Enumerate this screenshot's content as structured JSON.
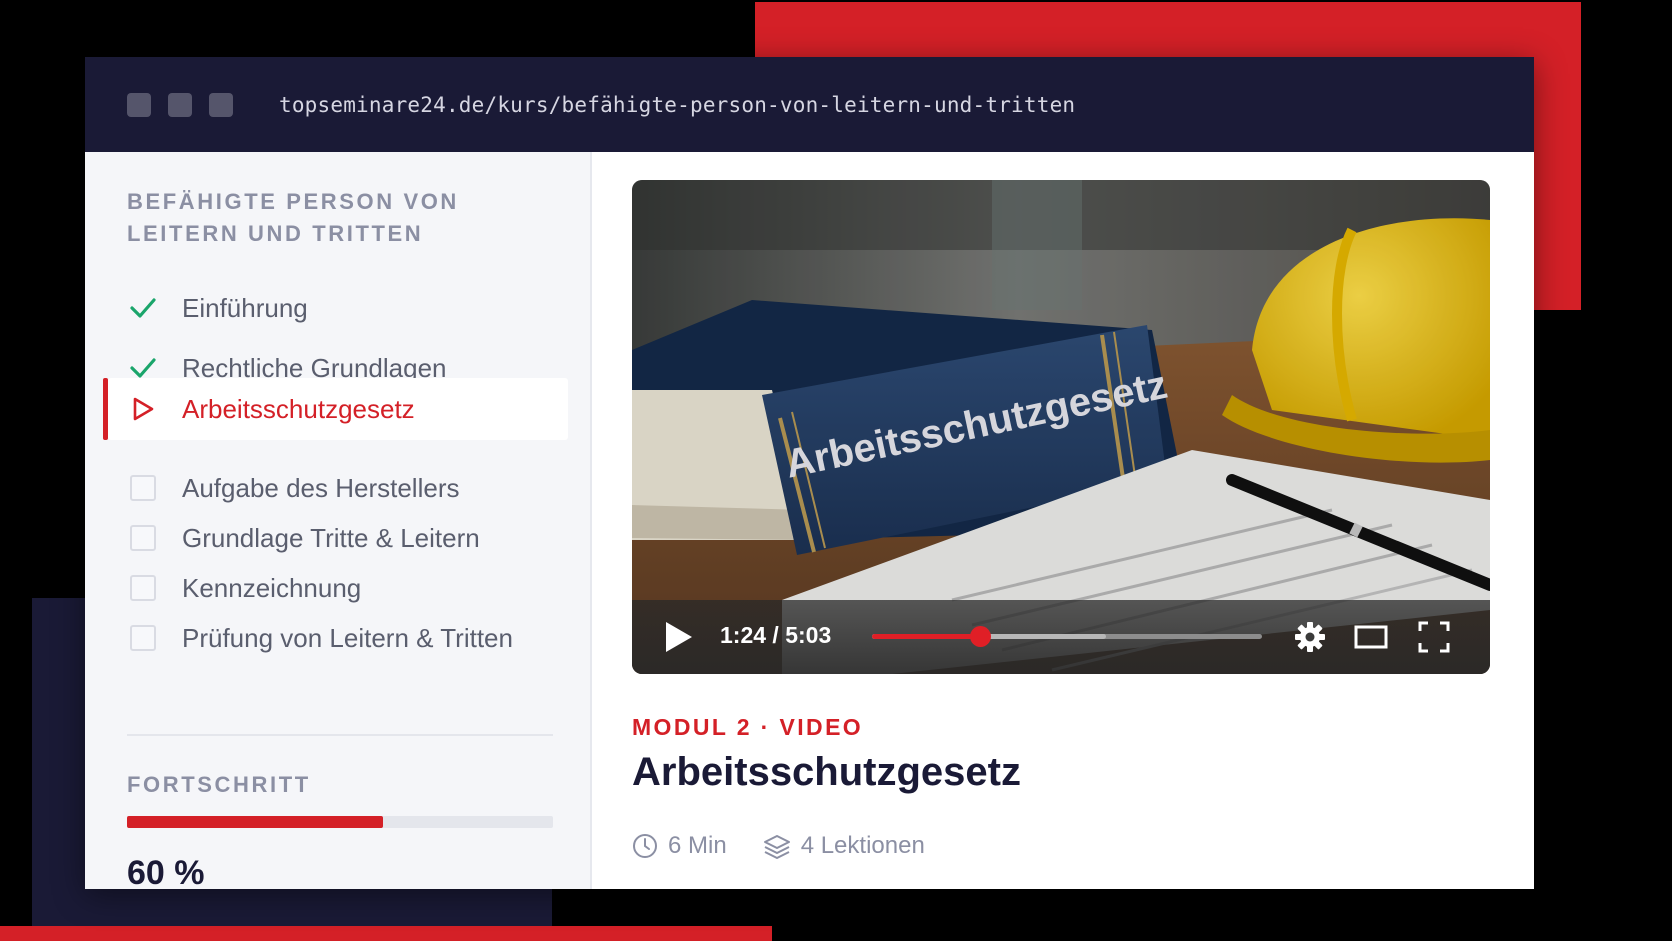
{
  "browser": {
    "url": "topseminare24.de/kurs/befähigte-person-von-leitern-und-tritten"
  },
  "sidebar": {
    "course_title": "BEFÄHIGTE PERSON VON LEITERN UND TRITTEN",
    "lessons": [
      {
        "label": "Einführung",
        "status": "completed",
        "icon": "check-icon"
      },
      {
        "label": "Rechtliche Grundlagen",
        "status": "completed",
        "icon": "check-icon"
      },
      {
        "label": "Arbeitsschutzgesetz",
        "status": "active",
        "icon": "play-outline-icon"
      },
      {
        "label": "Aufgabe des Herstellers",
        "status": "pending",
        "icon": "checkbox-icon"
      },
      {
        "label": "Grundlage Tritte & Leitern",
        "status": "pending",
        "icon": "checkbox-icon"
      },
      {
        "label": "Kennzeichnung",
        "status": "pending",
        "icon": "checkbox-icon"
      },
      {
        "label": "Prüfung von Leitern & Tritten",
        "status": "pending",
        "icon": "checkbox-icon"
      }
    ],
    "progress_label": "FORTSCHRITT",
    "progress_percent": 60,
    "progress_text": "60 %"
  },
  "video": {
    "book_spine_text": "Arbeitsschutzgesetz",
    "time_display": "1:24 / 5:03",
    "played_fraction": 0.277,
    "buffered_fraction": 0.6,
    "controls": [
      "play-icon",
      "settings-gear-icon",
      "theater-mode-icon",
      "fullscreen-icon"
    ]
  },
  "content": {
    "module_label": "MODUL 2 · VIDEO",
    "title": "Arbeitsschutzgesetz",
    "duration": "6 Min",
    "lessons_count": "4 Lektionen"
  },
  "colors": {
    "accent": "#d42027",
    "navy": "#1a1a36",
    "check_green": "#1aa56b",
    "muted": "#8b8fa3"
  }
}
